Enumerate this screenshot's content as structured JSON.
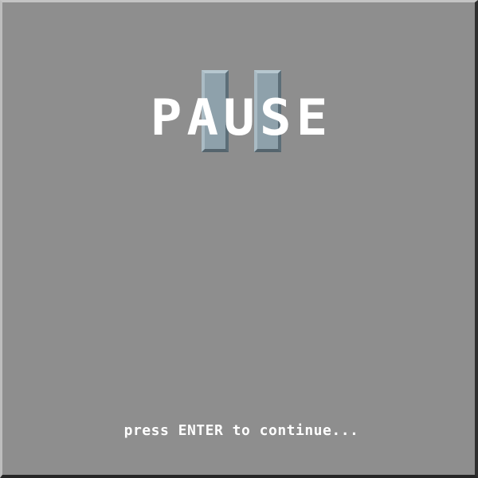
{
  "screen": {
    "title": "PAUSE",
    "prompt": "press ENTER to continue...",
    "icon": "pause-icon"
  },
  "colors": {
    "background": "#8e8e8e",
    "text": "#ffffff",
    "pause_bar": "#8ea1ab"
  }
}
